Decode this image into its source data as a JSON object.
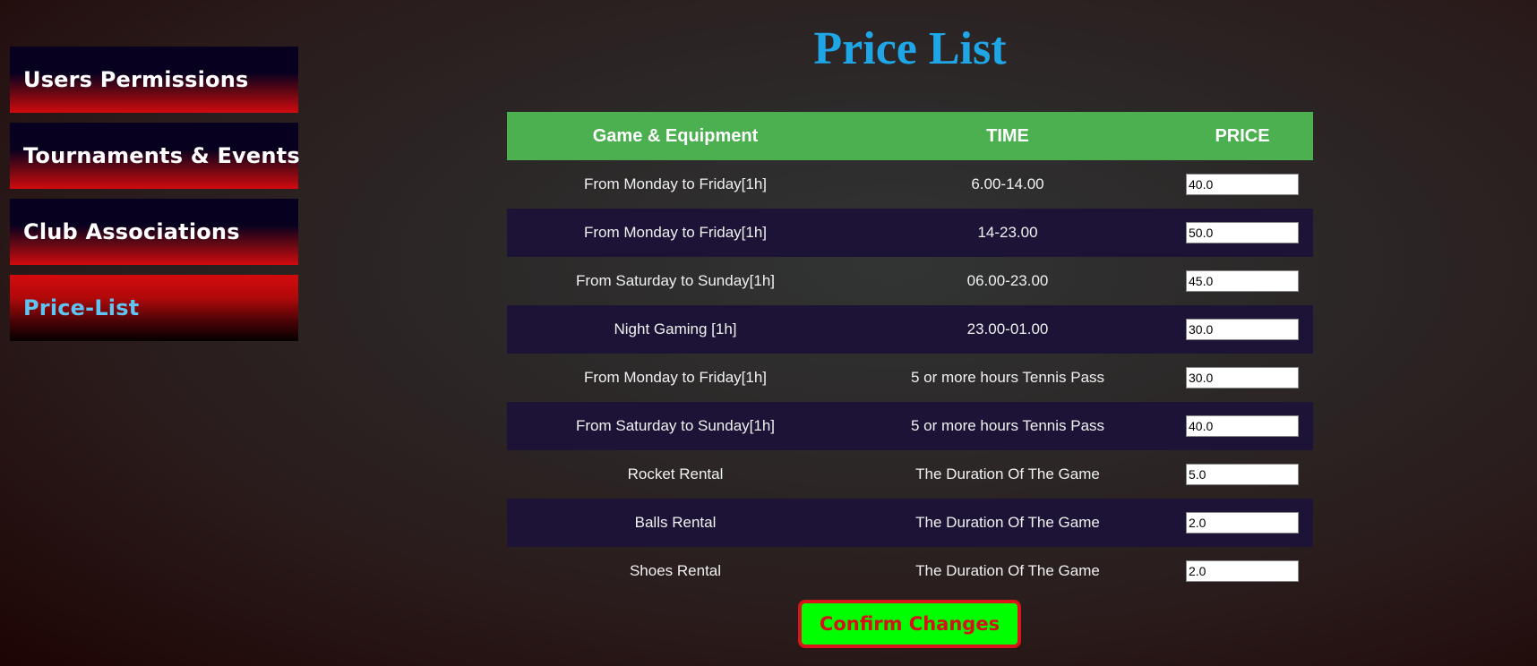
{
  "sidebar": {
    "items": [
      {
        "label": "Users Permissions",
        "active": false
      },
      {
        "label": "Tournaments & Events",
        "active": false
      },
      {
        "label": "Club Associations",
        "active": false
      },
      {
        "label": "Price-List",
        "active": true
      }
    ]
  },
  "header": {
    "title": "Price List"
  },
  "table": {
    "columns": [
      "Game & Equipment",
      "TIME",
      "PRICE"
    ],
    "rows": [
      {
        "game": "From Monday to Friday[1h]",
        "time": "6.00-14.00",
        "price": "40.0"
      },
      {
        "game": "From Monday to Friday[1h]",
        "time": "14-23.00",
        "price": "50.0"
      },
      {
        "game": "From Saturday to Sunday[1h]",
        "time": "06.00-23.00",
        "price": "45.0"
      },
      {
        "game": "Night Gaming [1h]",
        "time": "23.00-01.00",
        "price": "30.0"
      },
      {
        "game": "From Monday to Friday[1h]",
        "time": "5 or more hours Tennis Pass",
        "price": "30.0"
      },
      {
        "game": "From Saturday to Sunday[1h]",
        "time": "5 or more hours Tennis Pass",
        "price": "40.0"
      },
      {
        "game": "Rocket Rental",
        "time": "The Duration Of The Game",
        "price": "5.0"
      },
      {
        "game": "Balls Rental",
        "time": "The Duration Of The Game",
        "price": "2.0"
      },
      {
        "game": "Shoes Rental",
        "time": "The Duration Of The Game",
        "price": "2.0"
      }
    ]
  },
  "actions": {
    "confirm_label": "Confirm Changes"
  },
  "colors": {
    "title": "#1fa6e6",
    "header_bg": "#4caf50",
    "alt_row_bg": "#1d1336",
    "active_nav_text": "#5fc4f2",
    "confirm_bg": "#00ff00",
    "confirm_text": "#d61018"
  }
}
